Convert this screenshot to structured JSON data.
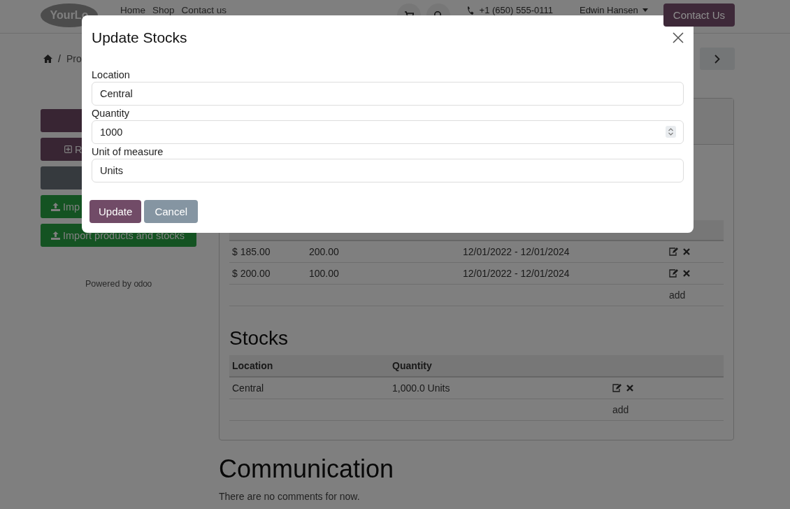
{
  "navbar": {
    "logo": "YourLo",
    "links": [
      "Home",
      "Shop",
      "Contact us"
    ],
    "phone": "+1 (650) 555-0111",
    "user": "Edwin Hansen",
    "cta": "Contact Us"
  },
  "breadcrumb": {
    "separator": "/",
    "current": "Pro"
  },
  "sidebar": {
    "buttons": [
      {
        "kind": "primary"
      },
      {
        "kind": "primary-add",
        "label": "R"
      },
      {
        "kind": "secondary"
      },
      {
        "kind": "import",
        "label": "Imp"
      },
      {
        "kind": "import",
        "label": "Import products and stocks"
      }
    ],
    "powered_by": "Powered by",
    "brand": "odoo"
  },
  "pricelist": {
    "rows": [
      {
        "price": "$ 185.00",
        "quantity": "200.00",
        "dates": "12/01/2022 - 12/01/2024"
      },
      {
        "price": "$ 200.00",
        "quantity": "100.00",
        "dates": "12/01/2022 - 12/01/2024"
      }
    ],
    "add": "add"
  },
  "stocks": {
    "title": "Stocks",
    "columns": [
      "Location",
      "Quantity"
    ],
    "rows": [
      {
        "location": "Central",
        "quantity": "1,000.0 Units"
      }
    ],
    "add": "add"
  },
  "communication": {
    "title": "Communication",
    "message": "There are no comments for now."
  },
  "modal": {
    "title": "Update Stocks",
    "fields": [
      {
        "label": "Location",
        "value": "Central",
        "kind": "text"
      },
      {
        "label": "Quantity",
        "value": "1000",
        "kind": "number"
      },
      {
        "label": "Unit of measure",
        "value": "Units",
        "kind": "text"
      }
    ],
    "buttons": [
      {
        "label": "Update",
        "kind": "primary"
      },
      {
        "label": "Cancel",
        "kind": "secondary"
      }
    ]
  }
}
